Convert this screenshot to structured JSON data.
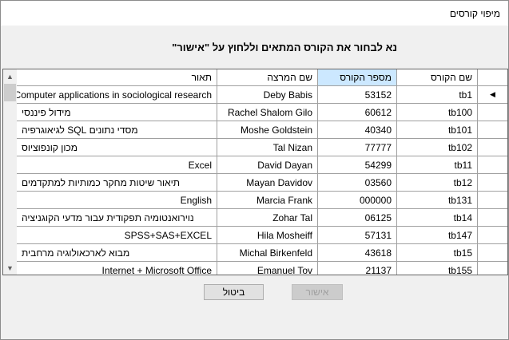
{
  "window": {
    "title": "מיפוי קורסים"
  },
  "instruction": "נא לבחור את הקורס המתאים וללחוץ על \"אישור\"",
  "table": {
    "columns": {
      "name": "שם הקורס",
      "number": "מספר הקורס",
      "lecturer": "שם המרצה",
      "description": "תאור"
    },
    "selected_row": 0,
    "rows": [
      {
        "name": "tb1",
        "number": "53152",
        "lecturer": "Deby Babis",
        "description": "Computer applications in sociological research"
      },
      {
        "name": "tb100",
        "number": "60612",
        "lecturer": "Rachel Shalom Gilo",
        "description": "מידול פיננסי"
      },
      {
        "name": "tb101",
        "number": "40340",
        "lecturer": "Moshe Goldstein",
        "description": "מסדי נתונים SQL לגיאוגרפיה"
      },
      {
        "name": "tb102",
        "number": "77777",
        "lecturer": "Tal Nizan",
        "description": "מכון קונפוציוס"
      },
      {
        "name": "tb11",
        "number": "54299",
        "lecturer": "David Dayan",
        "description": "Excel"
      },
      {
        "name": "tb12",
        "number": "03560",
        "lecturer": "Mayan Davidov",
        "description": "תיאור שיטות מחקר כמותיות למתקדמים"
      },
      {
        "name": "tb131",
        "number": "000000",
        "lecturer": "Marcia Frank",
        "description": "English"
      },
      {
        "name": "tb14",
        "number": "06125",
        "lecturer": "Zohar Tal",
        "description": "נוירואנטומיה תפקודית עבור מדעי הקוגניציה"
      },
      {
        "name": "tb147",
        "number": "57131",
        "lecturer": "Hila Mosheiff",
        "description": "SPSS+SAS+EXCEL"
      },
      {
        "name": "tb15",
        "number": "43618",
        "lecturer": "Michal Birkenfeld",
        "description": "מבוא לארכאולוגיה מרחבית"
      },
      {
        "name": "tb155",
        "number": "21137",
        "lecturer": "Emanuel Tov",
        "description": "Internet + Microsoft Office"
      }
    ]
  },
  "buttons": {
    "ok_label": "אישור",
    "cancel_label": "ביטול"
  },
  "icons": {
    "selector": "row-selector-arrow-icon",
    "scroll_up": "scroll-up-arrow-icon",
    "scroll_down": "scroll-down-arrow-icon"
  }
}
